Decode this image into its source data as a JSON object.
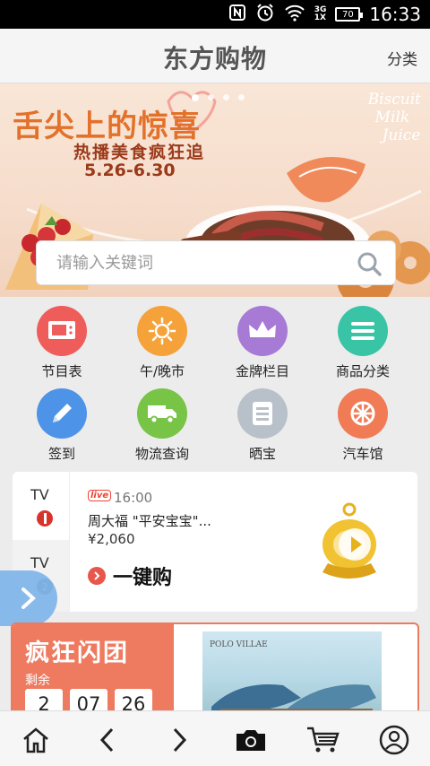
{
  "status_bar": {
    "time": "16:33",
    "battery": "70",
    "net_top": "3G",
    "net_bottom": "1X"
  },
  "header": {
    "logo": "东方购物",
    "category_btn": "分类"
  },
  "banner": {
    "title": "舌尖上的惊喜",
    "subtitle": "热播美食疯狂追",
    "date": "5.26-6.30",
    "script_lines": [
      "Biscuit",
      "Milk",
      "Juice"
    ]
  },
  "search": {
    "placeholder": "请输入关键词"
  },
  "grid": {
    "items": [
      {
        "label": "节目表",
        "color": "#ef5d5a"
      },
      {
        "label": "午/晚市",
        "color": "#f5a23b"
      },
      {
        "label": "金牌栏目",
        "color": "#a77ad6"
      },
      {
        "label": "商品分类",
        "color": "#38c4a5"
      },
      {
        "label": "签到",
        "color": "#4d93e8"
      },
      {
        "label": "物流查询",
        "color": "#78c447"
      },
      {
        "label": "晒宝",
        "color": "#b8c1ca"
      },
      {
        "label": "汽车馆",
        "color": "#f07b55"
      }
    ]
  },
  "tv": {
    "tab1": "TV",
    "tab2": "TV",
    "badge": "live",
    "time": "16:00",
    "product": "周大福 \"平安宝宝\"...",
    "price": "¥2,060",
    "buy": "一键购"
  },
  "flash_sale": {
    "title": "疯狂闪团",
    "remain": "剩余",
    "timer": [
      "2",
      "07",
      "26"
    ],
    "brand": "POLO VILLAE"
  }
}
